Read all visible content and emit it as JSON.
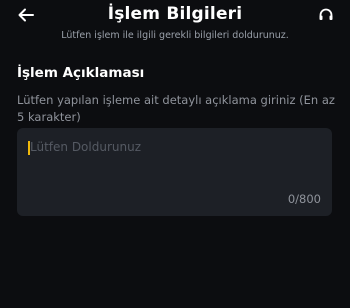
{
  "header": {
    "title": "İşlem Bilgileri",
    "subtitle": "Lütfen işlem ile ilgili gerekli bilgileri doldurunuz.",
    "back_icon": "arrow-left-icon",
    "support_icon": "headset-icon"
  },
  "section": {
    "title": "İşlem Açıklaması",
    "description": "Lütfen yapılan işleme ait detaylı açıklama giriniz (En az 5 karakter)"
  },
  "textarea": {
    "placeholder": "Lütfen Doldurunuz",
    "value": "",
    "counter": "0/800"
  },
  "colors": {
    "background": "#0c0d10",
    "input_bg": "#1d2026",
    "cursor": "#f0b90b",
    "muted_text": "#8f939b"
  }
}
